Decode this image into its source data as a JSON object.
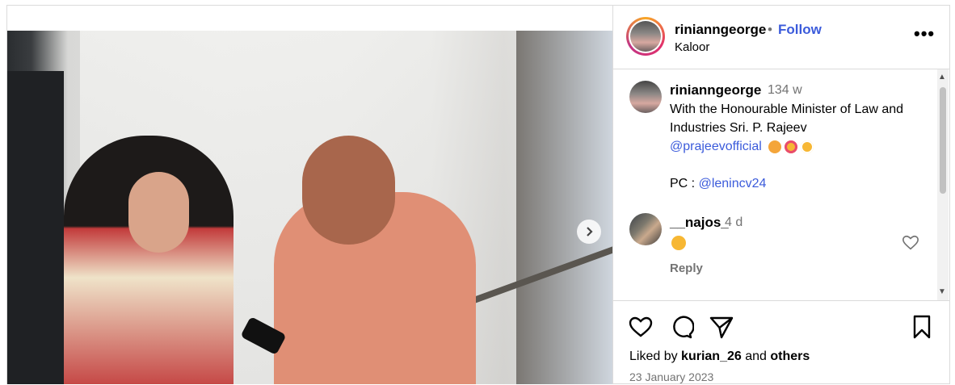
{
  "post": {
    "username": "rinianngeorge",
    "dot": "•",
    "follow_label": "Follow",
    "location": "Kaloor",
    "more_label": "•••"
  },
  "caption": {
    "username": "rinianngeorge",
    "time": "134 w",
    "text_line1": "With the Honourable Minister of Law and Industries Sri. P. Rajeev",
    "mention1": "@prajeevofficial",
    "pc_label": "PC :",
    "mention2": "@lenincv24"
  },
  "comment": {
    "username": "__najos_",
    "time": "4 d",
    "reply_label": "Reply"
  },
  "likes": {
    "prefix": "Liked by",
    "user": "kurian_26",
    "and": "and",
    "others": "others"
  },
  "date": "23 January 2023",
  "colors": {
    "link": "#3b5bdb",
    "muted": "#737373",
    "border": "#dbdbdb"
  },
  "icons": {
    "next": "chevron-right-icon",
    "like": "heart-icon",
    "comment": "comment-icon",
    "share": "send-icon",
    "save": "bookmark-icon"
  }
}
